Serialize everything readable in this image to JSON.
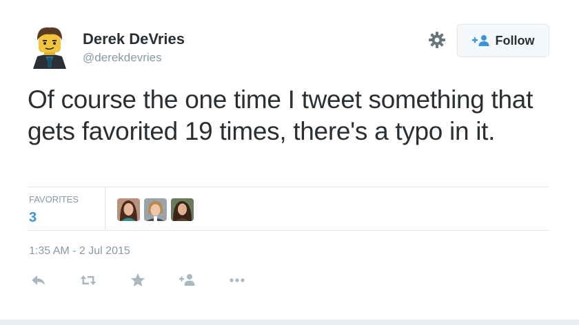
{
  "author": {
    "name": "Derek DeVries",
    "handle": "@derekdevries"
  },
  "follow_button": {
    "label": "Follow"
  },
  "tweet": {
    "text": "Of course the one time I tweet something that gets favorited 19 times, there's a typo in it."
  },
  "stats": {
    "favorites_label": "FAVORITES",
    "favorites_count": "3"
  },
  "timestamp": "1:35 AM - 2 Jul 2015",
  "colors": {
    "link_blue": "#3b94d9",
    "muted": "#8899a6",
    "border": "#e1e8ed"
  },
  "icons": [
    "gear-icon",
    "follow-person-plus-icon",
    "reply-icon",
    "retweet-icon",
    "favorite-star-icon",
    "follow-plus-icon",
    "more-dots-icon"
  ]
}
